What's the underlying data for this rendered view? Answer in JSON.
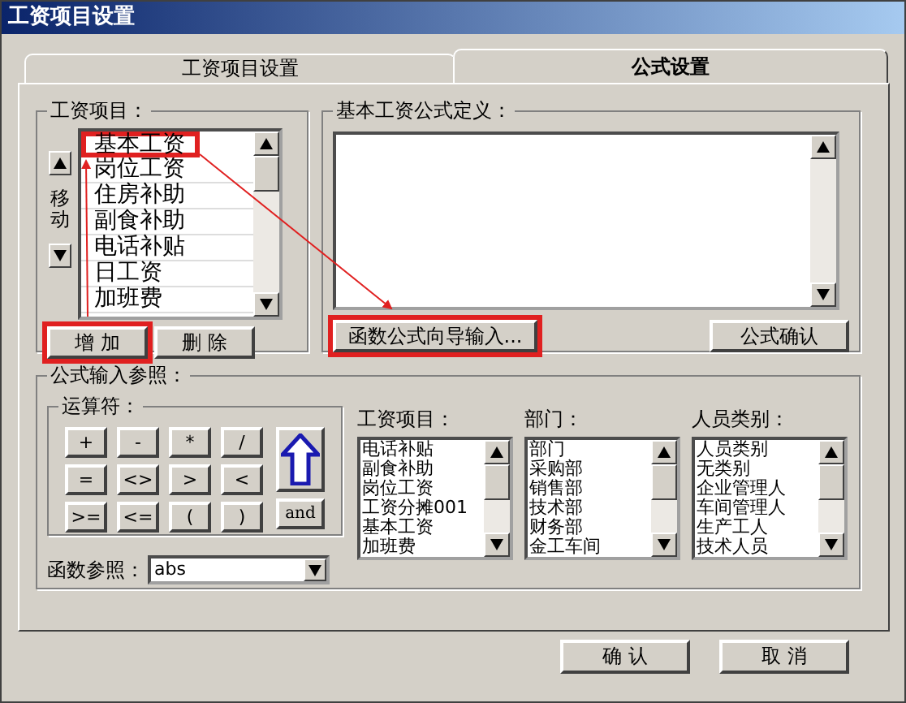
{
  "window": {
    "title": "工资项目设置"
  },
  "tabs": [
    {
      "label": "工资项目设置",
      "selected": false
    },
    {
      "label": "公式设置",
      "selected": true
    }
  ],
  "salary_items": {
    "title": "工资项目：",
    "move_label": "移动",
    "items": [
      {
        "label": "基本工资",
        "selected": false,
        "annotated": true
      },
      {
        "label": "岗位工资",
        "selected": false,
        "annotated": false
      },
      {
        "label": "住房补助",
        "selected": false,
        "annotated": false
      },
      {
        "label": "副食补助",
        "selected": false,
        "annotated": false
      },
      {
        "label": "电话补贴",
        "selected": false,
        "annotated": false
      },
      {
        "label": "日工资",
        "selected": false,
        "annotated": false
      },
      {
        "label": "加班费",
        "selected": false,
        "annotated": false
      }
    ],
    "buttons": [
      {
        "label": "增 加",
        "annotated": true
      },
      {
        "label": "删 除",
        "annotated": false
      }
    ]
  },
  "formula": {
    "title": "基本工资公式定义：",
    "wizard_button": {
      "label": "函数公式向导输入...",
      "annotated": true
    },
    "confirm_button": "公式确认"
  },
  "reference": {
    "title": "公式输入参照：",
    "operators_title": "运算符：",
    "operators": [
      "+",
      "-",
      "*",
      "/",
      "=",
      "<>",
      ">",
      "<",
      ">=",
      "<=",
      "(",
      ")"
    ],
    "and_button": "and",
    "function_label": "函数参照：",
    "function_value": "abs",
    "lists": [
      {
        "title": "工资项目：",
        "items": [
          "电话补贴",
          "副食补助",
          "岗位工资",
          "工资分摊001",
          "基本工资",
          "加班费"
        ]
      },
      {
        "title": "部门：",
        "items": [
          "部门",
          "采购部",
          "销售部",
          "技术部",
          "财务部",
          "金工车间"
        ]
      },
      {
        "title": "人员类别：",
        "items": [
          "人员类别",
          "无类别",
          "企业管理人",
          "车间管理人",
          "生产工人",
          "技术人员"
        ]
      }
    ]
  },
  "buttons": [
    "确 认",
    "取 消"
  ]
}
